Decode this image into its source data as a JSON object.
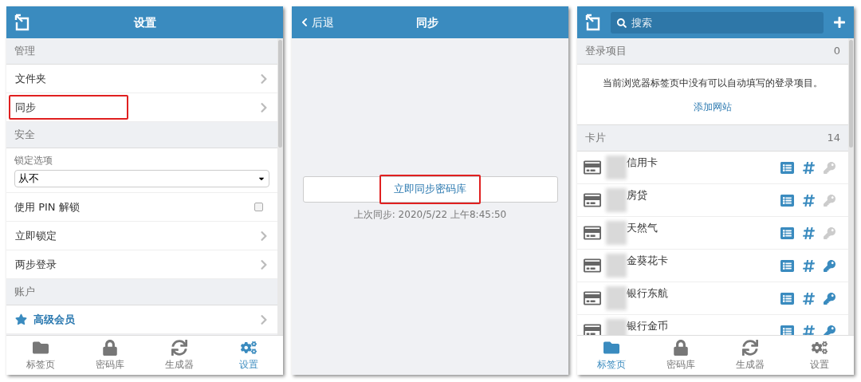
{
  "settings_panel": {
    "title": "设置",
    "sections": [
      {
        "title": "管理",
        "items": [
          {
            "kind": "link",
            "label": "文件夹",
            "highlighted": false
          },
          {
            "kind": "link",
            "label": "同步",
            "highlighted": true
          }
        ]
      },
      {
        "title": "安全",
        "items": [
          {
            "kind": "select",
            "label": "锁定选项",
            "value": "从不"
          },
          {
            "kind": "checkbox",
            "label": "使用 PIN 解锁",
            "checked": false
          },
          {
            "kind": "link",
            "label": "立即锁定",
            "highlighted": false
          },
          {
            "kind": "link",
            "label": "两步登录",
            "highlighted": false
          }
        ]
      },
      {
        "title": "账户",
        "items": [
          {
            "kind": "premium",
            "label": "高级会员",
            "highlighted": false
          }
        ]
      }
    ],
    "nav": [
      {
        "label": "标签页",
        "selected": false
      },
      {
        "label": "密码库",
        "selected": false
      },
      {
        "label": "生成器",
        "selected": false
      },
      {
        "label": "设置",
        "selected": true
      }
    ]
  },
  "sync_panel": {
    "back": "后退",
    "title": "同步",
    "button": {
      "label": "立即同步密码库",
      "highlighted": true
    },
    "last_sync": "上次同步: 2020/5/22 上午8:45:50"
  },
  "vault_panel": {
    "search": {
      "placeholder": "搜索"
    },
    "login_section": {
      "title": "登录项目",
      "count": "0",
      "message": "当前浏览器标签页中没有可以自动填写的登录项目。",
      "link": "添加网站"
    },
    "cards_section": {
      "title": "卡片",
      "count": "14",
      "items": [
        {
          "name": "信用卡",
          "key_active": false
        },
        {
          "name": "房贷",
          "key_active": false
        },
        {
          "name": "天然气",
          "key_active": false
        },
        {
          "name": "金葵花卡",
          "key_active": true
        },
        {
          "name": "银行东航",
          "key_active": true
        },
        {
          "name": "银行金币",
          "key_active": true
        }
      ]
    },
    "nav": [
      {
        "label": "标签页",
        "selected": true
      },
      {
        "label": "密码库",
        "selected": false
      },
      {
        "label": "生成器",
        "selected": false
      },
      {
        "label": "设置",
        "selected": false
      }
    ]
  }
}
